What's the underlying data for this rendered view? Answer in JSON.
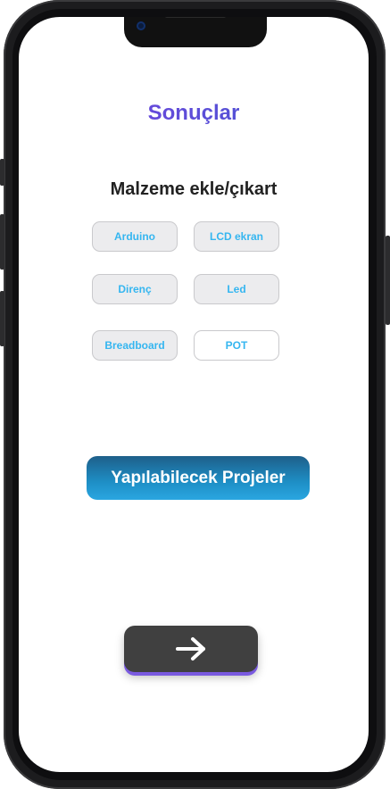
{
  "page": {
    "title": "Sonuçlar",
    "section_title": "Malzeme ekle/çıkart"
  },
  "materials": [
    {
      "label": "Arduino"
    },
    {
      "label": "LCD ekran"
    },
    {
      "label": "Direnç"
    },
    {
      "label": "Led"
    },
    {
      "label": "Breadboard"
    },
    {
      "label": "POT"
    }
  ],
  "actions": {
    "projects_label": "Yapılabilecek Projeler",
    "next_icon": "arrow-right-icon"
  },
  "colors": {
    "title_gradient": [
      "#7b3fe0",
      "#3f5bd0"
    ],
    "chip_text": "#35b6f0",
    "projects_button": "#1e8fc6",
    "next_button": "#404040",
    "next_button_shadow": "#7a5ae0"
  }
}
